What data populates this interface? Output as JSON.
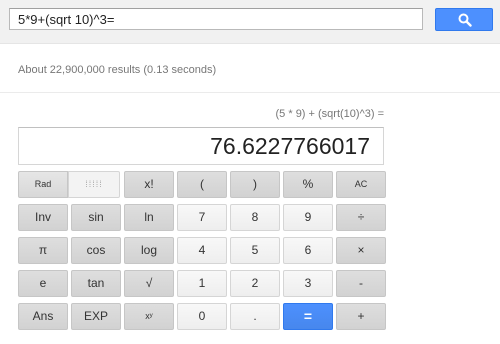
{
  "search": {
    "query": "5*9+(sqrt 10)^3=",
    "button_icon": "search-icon",
    "button_color": "#4d90fe"
  },
  "results_stats": "About 22,900,000 results (0.13 seconds)",
  "calculator": {
    "expression": "(5 * 9) + (sqrt(10)^3) =",
    "result": "76.6227766017",
    "accent_color": "#4d90fe",
    "keys": {
      "rad": "Rad",
      "deg": "Deg",
      "factorial": "x!",
      "open_paren": "(",
      "close_paren": ")",
      "percent": "%",
      "all_clear": "AC",
      "inv": "Inv",
      "sin": "sin",
      "ln": "ln",
      "seven": "7",
      "eight": "8",
      "nine": "9",
      "divide": "÷",
      "pi": "π",
      "cos": "cos",
      "log": "log",
      "four": "4",
      "five": "5",
      "six": "6",
      "multiply": "×",
      "e": "e",
      "tan": "tan",
      "sqrt": "√",
      "one": "1",
      "two": "2",
      "three": "3",
      "minus": "-",
      "ans": "Ans",
      "exp": "EXP",
      "power": "xʸ",
      "zero": "0",
      "decimal": ".",
      "equals": "=",
      "plus": "+"
    }
  }
}
